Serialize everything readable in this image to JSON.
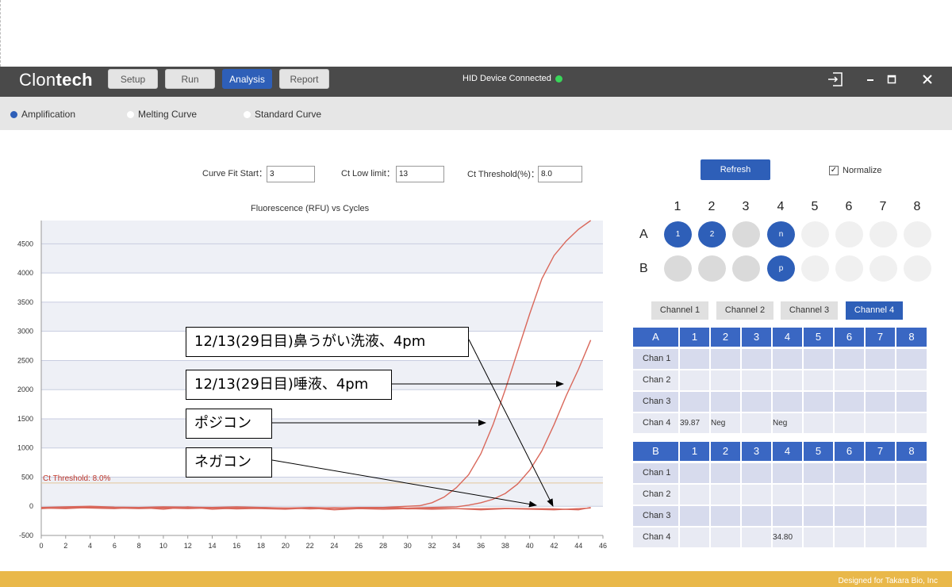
{
  "app": {
    "brand_light": "Clon",
    "brand_bold": "tech",
    "nav": [
      "Setup",
      "Run",
      "Analysis",
      "Report"
    ],
    "active_nav": "Analysis",
    "status": "HID Device Connected",
    "status_color": "#39d65a",
    "win_controls": [
      "exit-icon",
      "minimize-icon",
      "maximize-icon",
      "close-icon"
    ]
  },
  "tabs": [
    {
      "label": "Amplification",
      "selected": true
    },
    {
      "label": "Melting Curve",
      "selected": false
    },
    {
      "label": "Standard Curve",
      "selected": false
    }
  ],
  "params": {
    "curve_fit_label": "Curve Fit Start：",
    "curve_fit_value": "3",
    "ct_low_label": "Ct Low limit：",
    "ct_low_value": "13",
    "ct_threshold_label": "Ct Threshold(%)：",
    "ct_threshold_value": "8.0",
    "refresh": "Refresh",
    "normalize": "Normalize",
    "normalize_checked": true
  },
  "chart_data": {
    "type": "line",
    "title": "Fluorescence (RFU) vs Cycles",
    "xlim": [
      0,
      46
    ],
    "ylim": [
      -500,
      4900
    ],
    "x_ticks": [
      0,
      2,
      4,
      6,
      8,
      10,
      12,
      14,
      16,
      18,
      20,
      22,
      24,
      26,
      28,
      30,
      32,
      34,
      36,
      38,
      40,
      42,
      44,
      46
    ],
    "y_ticks": [
      -500,
      0,
      500,
      1000,
      1500,
      2000,
      2500,
      3000,
      3500,
      4000,
      4500
    ],
    "threshold_label": "Ct Threshold: 8.0%",
    "threshold_value": 400,
    "series": [
      {
        "x": [
          0,
          2,
          4,
          6,
          8,
          10,
          12,
          14,
          16,
          18,
          20,
          22,
          24,
          26,
          28,
          30,
          31,
          32,
          33,
          34,
          35,
          36,
          37,
          38,
          39,
          40,
          41,
          42,
          43,
          44,
          45
        ],
        "values": [
          -20,
          -10,
          0,
          -15,
          -20,
          -10,
          -15,
          -20,
          -10,
          -20,
          -30,
          -20,
          -30,
          -20,
          -20,
          0,
          10,
          60,
          160,
          320,
          540,
          900,
          1400,
          2000,
          2650,
          3300,
          3900,
          4300,
          4550,
          4750,
          4900
        ]
      },
      {
        "x": [
          0,
          2,
          4,
          6,
          8,
          10,
          12,
          14,
          16,
          18,
          20,
          22,
          24,
          26,
          28,
          30,
          32,
          34,
          35,
          36,
          37,
          38,
          39,
          40,
          41,
          42,
          43,
          44,
          45
        ],
        "values": [
          -30,
          -20,
          -10,
          -25,
          -30,
          -20,
          -30,
          -25,
          -30,
          -20,
          -35,
          -30,
          -25,
          -30,
          -25,
          -30,
          -20,
          -10,
          20,
          60,
          120,
          220,
          380,
          620,
          950,
          1400,
          1900,
          2350,
          2850
        ]
      },
      {
        "x": [
          0,
          2,
          4,
          6,
          8,
          10,
          12,
          14,
          16,
          18,
          20,
          22,
          24,
          26,
          28,
          30,
          32,
          34,
          36,
          38,
          40,
          42,
          44,
          45
        ],
        "values": [
          -40,
          -20,
          -30,
          -40,
          -20,
          -50,
          -10,
          -50,
          -30,
          -40,
          -50,
          -30,
          -60,
          -40,
          -50,
          -40,
          -50,
          -40,
          -60,
          -40,
          -50,
          -60,
          -40,
          -30
        ]
      },
      {
        "x": [
          0,
          2,
          4,
          6,
          8,
          10,
          12,
          14,
          16,
          18,
          20,
          22,
          24,
          26,
          28,
          30,
          32,
          34,
          36,
          38,
          40,
          42,
          44,
          45
        ],
        "values": [
          -30,
          -40,
          -20,
          -30,
          -40,
          -30,
          -40,
          -30,
          -45,
          -35,
          -30,
          -45,
          -35,
          -40,
          -30,
          -45,
          -35,
          -40,
          -45,
          -35,
          -40,
          -45,
          -60,
          -20
        ]
      }
    ],
    "line_color": "#d9675a",
    "threshold_color": "#e3c79a"
  },
  "callouts": [
    {
      "text": "12/13(29日目)鼻うがい洗液、4pm"
    },
    {
      "text": "12/13(29日目)唾液、4pm"
    },
    {
      "text": "ポジコン"
    },
    {
      "text": "ネガコン"
    }
  ],
  "plate": {
    "columns": [
      "1",
      "2",
      "3",
      "4",
      "5",
      "6",
      "7",
      "8"
    ],
    "rows": [
      "A",
      "B"
    ],
    "wells": [
      [
        {
          "label": "1",
          "state": "blue"
        },
        {
          "label": "2",
          "state": "blue"
        },
        {
          "label": "",
          "state": "gray"
        },
        {
          "label": "n",
          "state": "blue"
        },
        {
          "label": "",
          "state": "empty"
        },
        {
          "label": "",
          "state": "empty"
        },
        {
          "label": "",
          "state": "empty"
        },
        {
          "label": "",
          "state": "empty"
        }
      ],
      [
        {
          "label": "",
          "state": "gray"
        },
        {
          "label": "",
          "state": "gray"
        },
        {
          "label": "",
          "state": "gray"
        },
        {
          "label": "p",
          "state": "blue"
        },
        {
          "label": "",
          "state": "empty"
        },
        {
          "label": "",
          "state": "empty"
        },
        {
          "label": "",
          "state": "empty"
        },
        {
          "label": "",
          "state": "empty"
        }
      ]
    ]
  },
  "channels": [
    {
      "label": "Channel 1",
      "active": false
    },
    {
      "label": "Channel 2",
      "active": false
    },
    {
      "label": "Channel 3",
      "active": false
    },
    {
      "label": "Channel 4",
      "active": true
    }
  ],
  "tables": [
    {
      "row": "A",
      "columns": [
        "1",
        "2",
        "3",
        "4",
        "5",
        "6",
        "7",
        "8"
      ],
      "rows": [
        {
          "label": "Chan 1",
          "cells": [
            "",
            "",
            "",
            "",
            "",
            "",
            "",
            ""
          ]
        },
        {
          "label": "Chan 2",
          "cells": [
            "",
            "",
            "",
            "",
            "",
            "",
            "",
            ""
          ]
        },
        {
          "label": "Chan 3",
          "cells": [
            "",
            "",
            "",
            "",
            "",
            "",
            "",
            ""
          ]
        },
        {
          "label": "Chan 4",
          "cells": [
            "39.87",
            "Neg",
            "",
            "Neg",
            "",
            "",
            "",
            ""
          ]
        }
      ]
    },
    {
      "row": "B",
      "columns": [
        "1",
        "2",
        "3",
        "4",
        "5",
        "6",
        "7",
        "8"
      ],
      "rows": [
        {
          "label": "Chan 1",
          "cells": [
            "",
            "",
            "",
            "",
            "",
            "",
            "",
            ""
          ]
        },
        {
          "label": "Chan 2",
          "cells": [
            "",
            "",
            "",
            "",
            "",
            "",
            "",
            ""
          ]
        },
        {
          "label": "Chan 3",
          "cells": [
            "",
            "",
            "",
            "",
            "",
            "",
            "",
            ""
          ]
        },
        {
          "label": "Chan 4",
          "cells": [
            "",
            "",
            "",
            "34.80",
            "",
            "",
            "",
            ""
          ]
        }
      ]
    }
  ],
  "footer": "Designed for Takara Bio, Inc"
}
